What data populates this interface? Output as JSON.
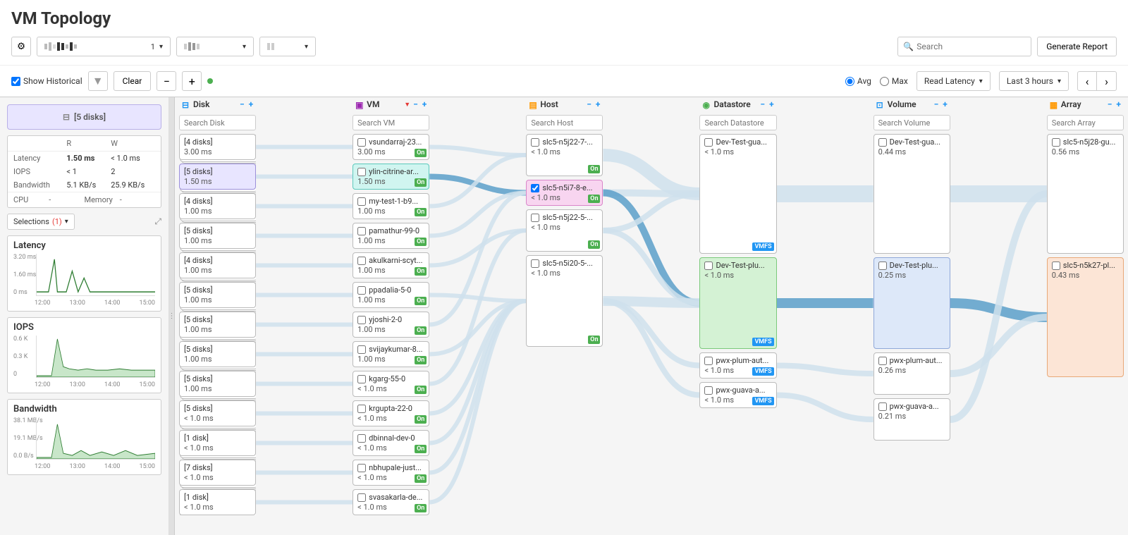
{
  "page_title": "VM Topology",
  "topbar": {
    "search_placeholder": "Search",
    "generate_report": "Generate Report"
  },
  "controls": {
    "show_historical": "Show Historical",
    "clear": "Clear",
    "avg": "Avg",
    "max": "Max",
    "metric_dd": "Read Latency",
    "range_dd": "Last 3 hours"
  },
  "sidebar": {
    "summary": "[5 disks]",
    "stats": {
      "r_label": "R",
      "w_label": "W",
      "latency_label": "Latency",
      "latency_r": "1.50 ms",
      "latency_w": "< 1.0 ms",
      "iops_label": "IOPS",
      "iops_r": "< 1",
      "iops_w": "2",
      "bw_label": "Bandwidth",
      "bw_r": "5.1 KB/s",
      "bw_w": "25.9 KB/s",
      "cpu_label": "CPU",
      "cpu_val": "-",
      "mem_label": "Memory",
      "mem_val": "-"
    },
    "selections_label": "Selections",
    "selections_count": "(1)",
    "charts": {
      "latency": {
        "title": "Latency",
        "y": [
          "3.20 ms",
          "1.60 ms",
          "0 ms"
        ],
        "x": [
          "12:00",
          "13:00",
          "14:00",
          "15:00"
        ]
      },
      "iops": {
        "title": "IOPS",
        "y": [
          "0.6 K",
          "0.3 K",
          "0"
        ],
        "x": [
          "12:00",
          "13:00",
          "14:00",
          "15:00"
        ]
      },
      "bw": {
        "title": "Bandwidth",
        "y": [
          "38.1 MB/s",
          "19.1 MB/s",
          "0.0 B/s"
        ],
        "x": [
          "12:00",
          "13:00",
          "14:00",
          "15:00"
        ]
      }
    }
  },
  "columns": {
    "disk": {
      "title": "Disk",
      "search": "Search Disk",
      "nodes": [
        {
          "t": "[4 disks]",
          "v": "3.00 ms"
        },
        {
          "t": "[5 disks]",
          "v": "1.50 ms",
          "sel": "purple"
        },
        {
          "t": "[4 disks]",
          "v": "1.00 ms"
        },
        {
          "t": "[5 disks]",
          "v": "1.00 ms"
        },
        {
          "t": "[4 disks]",
          "v": "1.00 ms"
        },
        {
          "t": "[5 disks]",
          "v": "1.00 ms"
        },
        {
          "t": "[5 disks]",
          "v": "1.00 ms"
        },
        {
          "t": "[5 disks]",
          "v": "1.00 ms"
        },
        {
          "t": "[5 disks]",
          "v": "1.00 ms"
        },
        {
          "t": "[5 disks]",
          "v": "< 1.0 ms"
        },
        {
          "t": "[1 disk]",
          "v": "< 1.0 ms"
        },
        {
          "t": "[7 disks]",
          "v": "< 1.0 ms"
        },
        {
          "t": "[1 disk]",
          "v": "< 1.0 ms"
        }
      ]
    },
    "vm": {
      "title": "VM",
      "search": "Search VM",
      "nodes": [
        {
          "t": "vsundarraj-23...",
          "v": "3.00 ms",
          "b": "On"
        },
        {
          "t": "ylin-citrine-ar...",
          "v": "1.50 ms",
          "b": "On",
          "sel": "cyan"
        },
        {
          "t": "my-test-1-b9...",
          "v": "1.00 ms",
          "b": "On"
        },
        {
          "t": "pamathur-99-0",
          "v": "1.00 ms",
          "b": "On"
        },
        {
          "t": "akulkarni-scyt...",
          "v": "1.00 ms",
          "b": "On"
        },
        {
          "t": "ppadalia-5-0",
          "v": "1.00 ms",
          "b": "On"
        },
        {
          "t": "yjoshi-2-0",
          "v": "1.00 ms",
          "b": "On"
        },
        {
          "t": "svijaykumar-8...",
          "v": "1.00 ms",
          "b": "On"
        },
        {
          "t": "kgarg-55-0",
          "v": "< 1.0 ms",
          "b": "On"
        },
        {
          "t": "krgupta-22-0",
          "v": "< 1.0 ms",
          "b": "On"
        },
        {
          "t": "dbinnal-dev-0",
          "v": "< 1.0 ms",
          "b": "On"
        },
        {
          "t": "nbhupale-just...",
          "v": "< 1.0 ms",
          "b": "On"
        },
        {
          "t": "svasakarla-de...",
          "v": "< 1.0 ms",
          "b": "On"
        }
      ]
    },
    "host": {
      "title": "Host",
      "search": "Search Host",
      "nodes": [
        {
          "t": "slc5-n5j22-7-...",
          "v": "< 1.0 ms",
          "b": "On",
          "h": "short"
        },
        {
          "t": "slc5-n5i7-8-e...",
          "v": "< 1.0 ms",
          "b": "On",
          "sel": "pink",
          "chk": true
        },
        {
          "t": "slc5-n5j22-5-...",
          "v": "< 1.0 ms",
          "b": "On",
          "h": "short"
        },
        {
          "t": "slc5-n5i20-5-...",
          "v": "< 1.0 ms",
          "b": "On",
          "h": "med"
        }
      ]
    },
    "datastore": {
      "title": "Datastore",
      "search": "Search Datastore",
      "nodes": [
        {
          "t": "Dev-Test-gua...",
          "v": "< 1.0 ms",
          "b": "VMFS",
          "bcls": "vmfs",
          "h": "tall"
        },
        {
          "t": "Dev-Test-plu...",
          "v": "< 1.0 ms",
          "b": "VMFS",
          "bcls": "vmfs",
          "sel": "green",
          "h": "med"
        },
        {
          "t": "pwx-plum-aut...",
          "v": "< 1.0 ms",
          "b": "VMFS",
          "bcls": "vmfs"
        },
        {
          "t": "pwx-guava-a...",
          "v": "< 1.0 ms",
          "b": "VMFS",
          "bcls": "vmfs"
        }
      ]
    },
    "volume": {
      "title": "Volume",
      "search": "Search Volume",
      "nodes": [
        {
          "t": "Dev-Test-gua...",
          "v": "0.44 ms",
          "h": "tall"
        },
        {
          "t": "Dev-Test-plu...",
          "v": "0.25 ms",
          "sel": "blue",
          "h": "med"
        },
        {
          "t": "pwx-plum-aut...",
          "v": "0.26 ms",
          "h": "short"
        },
        {
          "t": "pwx-guava-a...",
          "v": "0.21 ms",
          "h": "short"
        }
      ]
    },
    "array": {
      "title": "Array",
      "search": "Search Array",
      "nodes": [
        {
          "t": "slc5-n5j28-gu...",
          "v": "0.56 ms",
          "h": "tall"
        },
        {
          "t": "slc5-n5k27-pl...",
          "v": "0.43 ms",
          "sel": "orange",
          "h": "tall"
        }
      ]
    }
  },
  "chart_data": [
    {
      "type": "line",
      "title": "Latency",
      "x": [
        "12:00",
        "13:00",
        "14:00",
        "15:00"
      ],
      "ylabel": "",
      "ylim": [
        0,
        3.2
      ],
      "series": [
        {
          "name": "read",
          "values": [
            0.2,
            0.2,
            2.8,
            0.3,
            0.2,
            1.6,
            0.3,
            1.2,
            0.2,
            0.2,
            0.2,
            0.2
          ]
        }
      ]
    },
    {
      "type": "line",
      "title": "IOPS",
      "x": [
        "12:00",
        "13:00",
        "14:00",
        "15:00"
      ],
      "ylabel": "",
      "ylim": [
        0,
        600
      ],
      "series": [
        {
          "name": "iops",
          "values": [
            20,
            20,
            500,
            100,
            80,
            60,
            60,
            80,
            60,
            60,
            60,
            60
          ]
        }
      ]
    },
    {
      "type": "line",
      "title": "Bandwidth",
      "x": [
        "12:00",
        "13:00",
        "14:00",
        "15:00"
      ],
      "ylabel": "",
      "ylim": [
        0,
        38.1
      ],
      "series": [
        {
          "name": "bw",
          "values": [
            1,
            1,
            30,
            3,
            2,
            5,
            2,
            4,
            2,
            5,
            2,
            3
          ]
        }
      ]
    }
  ]
}
